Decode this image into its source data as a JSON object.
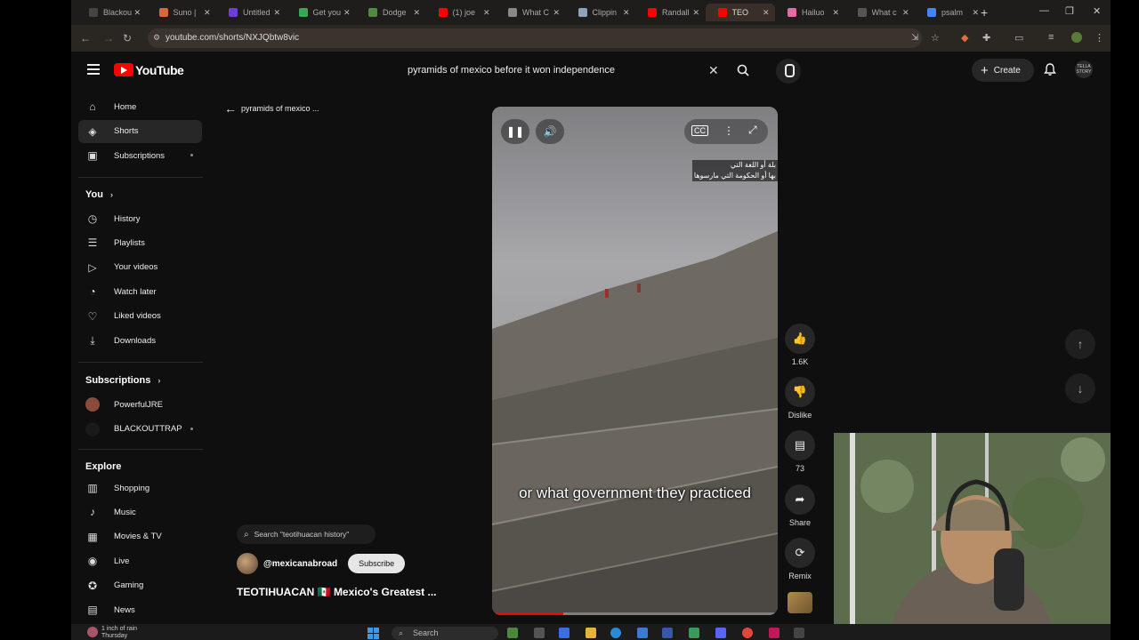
{
  "browser": {
    "tabs": [
      {
        "label": "Blackou",
        "color": "#444444"
      },
      {
        "label": "Suno |",
        "color": "#d9653b"
      },
      {
        "label": "Untitled",
        "color": "#6e3fd6"
      },
      {
        "label": "Get you",
        "color": "#3aa657"
      },
      {
        "label": "Dodge",
        "color": "#4c8c3c"
      },
      {
        "label": "(1) joe",
        "color": "#ff0000"
      },
      {
        "label": "What C",
        "color": "#888888"
      },
      {
        "label": "Clippin",
        "color": "#8ea3b8"
      },
      {
        "label": "Randall",
        "color": "#ff0000"
      },
      {
        "label": "TEO",
        "color": "#ff0000"
      },
      {
        "label": "Hailuo",
        "color": "#e36aa4"
      },
      {
        "label": "What c",
        "color": "#555555"
      },
      {
        "label": "psalm",
        "color": "#4285f4"
      }
    ],
    "active_tab_index": 9,
    "url": "youtube.com/shorts/NXJQbtw8vic"
  },
  "header": {
    "logo_text": "YouTube",
    "search_query": "pyramids of mexico before it won independence",
    "create_label": "Create",
    "avatar_text": "TELLA STORY"
  },
  "sidebar": {
    "main_items": [
      {
        "label": "Home",
        "icon": "home-icon"
      },
      {
        "label": "Shorts",
        "icon": "shorts-icon"
      },
      {
        "label": "Subscriptions",
        "icon": "subscriptions-icon"
      }
    ],
    "you_heading": "You",
    "you_items": [
      {
        "label": "History",
        "icon": "history-icon"
      },
      {
        "label": "Playlists",
        "icon": "playlists-icon"
      },
      {
        "label": "Your videos",
        "icon": "your-videos-icon"
      },
      {
        "label": "Watch later",
        "icon": "watch-later-icon"
      },
      {
        "label": "Liked videos",
        "icon": "liked-videos-icon"
      },
      {
        "label": "Downloads",
        "icon": "downloads-icon"
      }
    ],
    "subscriptions_heading": "Subscriptions",
    "subscription_items": [
      {
        "label": "PowerfulJRE"
      },
      {
        "label": "BLACKOUTTRAP"
      }
    ],
    "explore_heading": "Explore",
    "explore_items": [
      {
        "label": "Shopping",
        "icon": "shopping-icon"
      },
      {
        "label": "Music",
        "icon": "music-icon"
      },
      {
        "label": "Movies & TV",
        "icon": "movies-icon"
      },
      {
        "label": "Live",
        "icon": "live-icon"
      },
      {
        "label": "Gaming",
        "icon": "gaming-icon"
      },
      {
        "label": "News",
        "icon": "news-icon"
      }
    ]
  },
  "player": {
    "back_title": "pyramids of mexico ...",
    "subtitle_arabic_line1": "بلة أو اللغة التي",
    "subtitle_arabic_line2": "بها أو الحكومة التي مارسوها",
    "caption": "or what government they practiced",
    "progress": 0.25,
    "related_search": "Search \"teotihuacan history\"",
    "channel": "@mexicanabroad",
    "subscribe_label": "Subscribe",
    "title": "TEOTIHUACAN 🇲🇽 Mexico's Greatest ..."
  },
  "actions": {
    "likes": "1.6K",
    "dislike_label": "Dislike",
    "comments": "73",
    "share_label": "Share",
    "remix_label": "Remix"
  },
  "taskbar": {
    "weather_line1": "1 inch of rain",
    "weather_line2": "Thursday",
    "search_label": "Search"
  }
}
